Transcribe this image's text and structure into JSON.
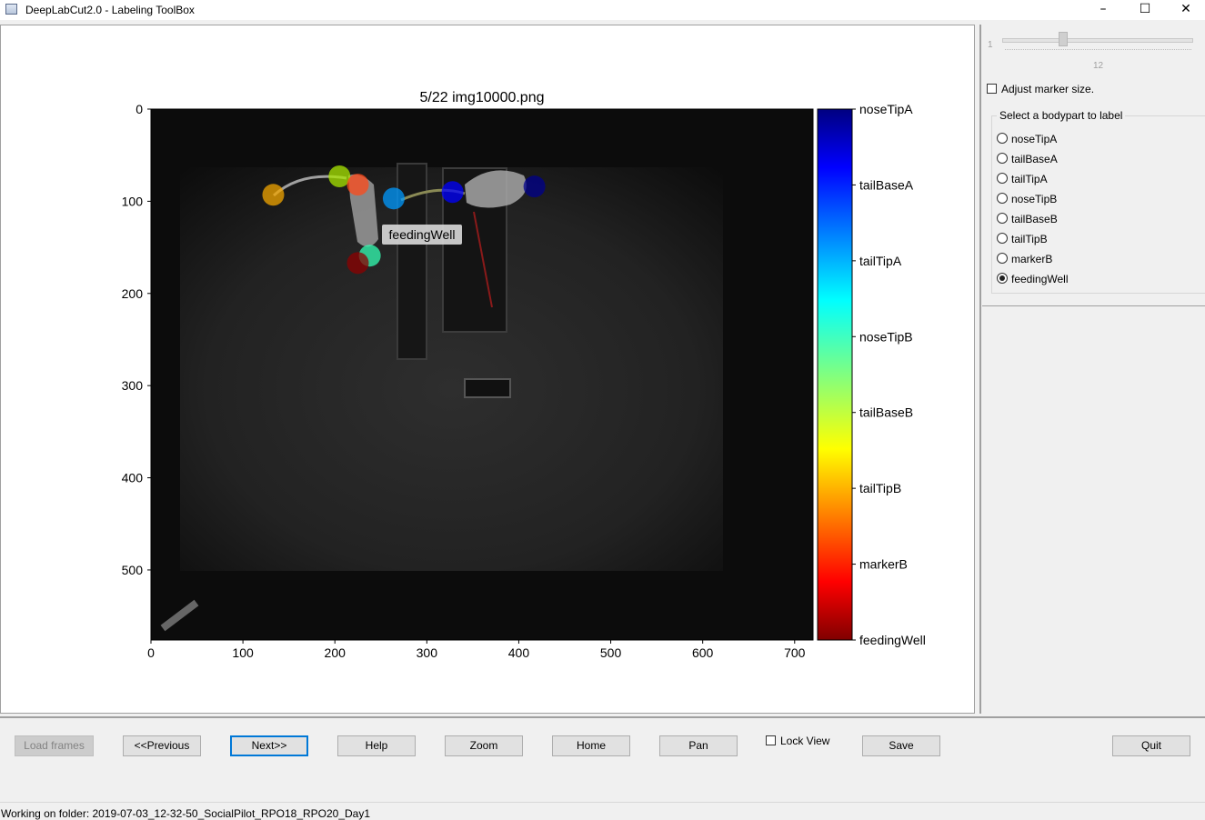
{
  "window": {
    "title": "DeepLabCut2.0 - Labeling ToolBox",
    "minimize_glyph": "–",
    "maximize_glyph": "☐",
    "close_glyph": "✕"
  },
  "plot": {
    "title": "5/22 img10000.png",
    "x_ticks": [
      "0",
      "100",
      "200",
      "300",
      "400",
      "500",
      "600",
      "700"
    ],
    "y_ticks": [
      "0",
      "100",
      "200",
      "300",
      "400",
      "500"
    ],
    "xlim": [
      0,
      720
    ],
    "ylim": [
      576,
      0
    ],
    "hover_label": "feedingWell",
    "markers": [
      {
        "bodypart": "noseTipA",
        "x": 417,
        "y": 84,
        "color": "#00008c"
      },
      {
        "bodypart": "tailBaseA",
        "x": 328,
        "y": 90,
        "color": "#0000ff"
      },
      {
        "bodypart": "tailTipA",
        "x": 264,
        "y": 97,
        "color": "#0099ff"
      },
      {
        "bodypart": "noseTipB",
        "x": 238,
        "y": 159,
        "color": "#33ffb3"
      },
      {
        "bodypart": "tailBaseB",
        "x": 205,
        "y": 73,
        "color": "#a8e600"
      },
      {
        "bodypart": "tailTipB",
        "x": 133,
        "y": 93,
        "color": "#f2a600"
      },
      {
        "bodypart": "markerB",
        "x": 225,
        "y": 82,
        "color": "#ff4a1a"
      },
      {
        "bodypart": "feedingWell",
        "x": 225,
        "y": 167,
        "color": "#8c0000"
      }
    ]
  },
  "colorbar": {
    "labels": [
      "noseTipA",
      "tailBaseA",
      "tailTipA",
      "noseTipB",
      "tailBaseB",
      "tailTipB",
      "markerB",
      "feedingWell"
    ]
  },
  "side_panel": {
    "slider_min": "1",
    "slider_value": "12",
    "adjust_marker_label": "Adjust marker size.",
    "group_title": "Select a bodypart to label",
    "bodyparts": [
      "noseTipA",
      "tailBaseA",
      "tailTipA",
      "noseTipB",
      "tailBaseB",
      "tailTipB",
      "markerB",
      "feedingWell"
    ],
    "selected_bodypart": "feedingWell"
  },
  "toolbar": {
    "load_frames": "Load frames",
    "previous": "<<Previous",
    "next": "Next>>",
    "help": "Help",
    "zoom": "Zoom",
    "home": "Home",
    "pan": "Pan",
    "lock_view": "Lock View",
    "save": "Save",
    "quit": "Quit"
  },
  "status": {
    "text": "Working on folder: 2019-07-03_12-32-50_SocialPilot_RPO18_RPO20_Day1"
  }
}
